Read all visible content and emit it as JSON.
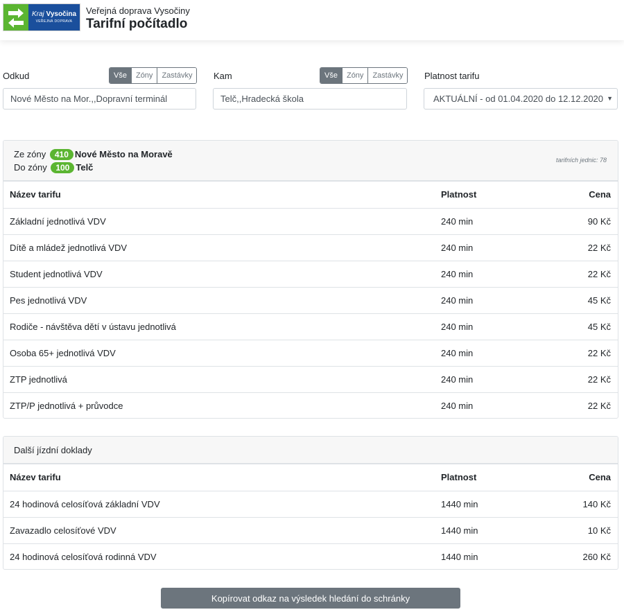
{
  "header": {
    "logo_text_1": "Kraj",
    "logo_text_2": "Vysočina",
    "logo_text_3": "VEŘEJNÁ DOPRAVA",
    "subtitle": "Veřejná doprava Vysočiny",
    "title": "Tarifní počítadlo"
  },
  "filters": {
    "from": {
      "label": "Odkud",
      "tabs": [
        "Vše",
        "Zóny",
        "Zastávky"
      ],
      "active_tab": "Vše",
      "value": "Nové Město na Mor.,,Dopravní terminál"
    },
    "to": {
      "label": "Kam",
      "tabs": [
        "Vše",
        "Zóny",
        "Zastávky"
      ],
      "active_tab": "Vše",
      "value": "Telč,,Hradecká škola"
    },
    "validity": {
      "label": "Platnost tarifu",
      "selected": "AKTUÁLNÍ - od 01.04.2020 do 12.12.2020"
    }
  },
  "zones": {
    "from_prefix": "Ze zóny",
    "from_code": "410",
    "from_name": "Nové Město na Moravě",
    "to_prefix": "Do zóny",
    "to_code": "100",
    "to_name": "Telč",
    "units": "tarifních jednic: 78"
  },
  "table_headers": {
    "name": "Název tarifu",
    "validity": "Platnost",
    "price": "Cena"
  },
  "tariffs": [
    {
      "name": "Základní jednotlivá VDV",
      "validity": "240 min",
      "price": "90 Kč"
    },
    {
      "name": "Dítě a mládež jednotlivá VDV",
      "validity": "240 min",
      "price": "22 Kč"
    },
    {
      "name": "Student jednotlivá VDV",
      "validity": "240 min",
      "price": "22 Kč"
    },
    {
      "name": "Pes jednotlivá VDV",
      "validity": "240 min",
      "price": "45 Kč"
    },
    {
      "name": "Rodiče - návštěva dětí v ústavu jednotlivá",
      "validity": "240 min",
      "price": "45 Kč"
    },
    {
      "name": "Osoba 65+ jednotlivá VDV",
      "validity": "240 min",
      "price": "22 Kč"
    },
    {
      "name": "ZTP jednotlivá",
      "validity": "240 min",
      "price": "22 Kč"
    },
    {
      "name": "ZTP/P jednotlivá + průvodce",
      "validity": "240 min",
      "price": "22 Kč"
    }
  ],
  "other": {
    "title": "Další jízdní doklady",
    "rows": [
      {
        "name": "24 hodinová celosíťová základní VDV",
        "validity": "1440 min",
        "price": "140 Kč"
      },
      {
        "name": "Zavazadlo celosíťové VDV",
        "validity": "1440 min",
        "price": "10 Kč"
      },
      {
        "name": "24 hodinová celosíťová rodinná VDV",
        "validity": "1440 min",
        "price": "260 Kč"
      }
    ]
  },
  "copy_button": "Kopírovat odkaz na výsledek hledání do schránky",
  "colors": {
    "brand_green": "#5bb531",
    "brand_blue": "#1a4f9c",
    "button_gray": "#6c757d"
  }
}
